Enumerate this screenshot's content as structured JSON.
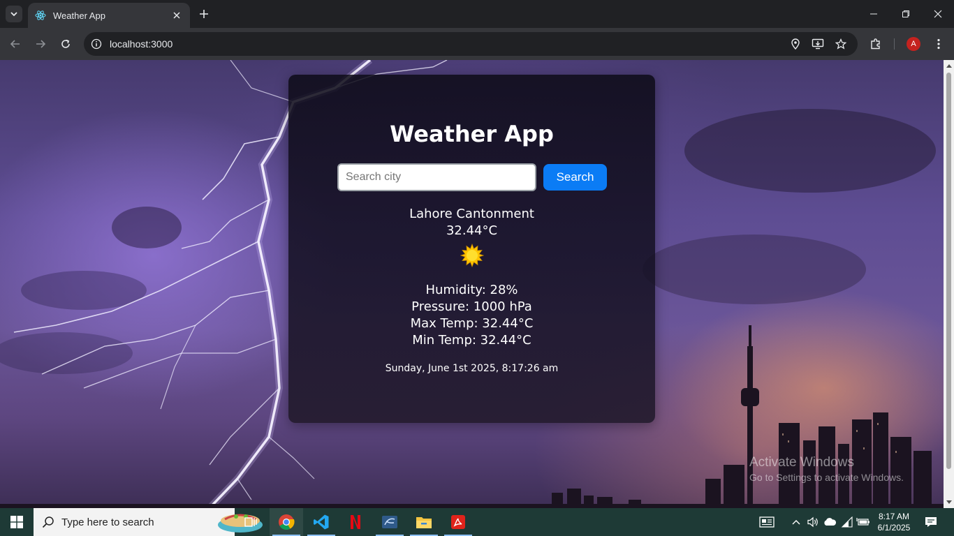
{
  "browser": {
    "tab_title": "Weather App",
    "url": "localhost:3000",
    "profile_initial": "A"
  },
  "app": {
    "title": "Weather App",
    "search_placeholder": "Search city",
    "search_value": "",
    "search_button": "Search",
    "city": "Lahore Cantonment",
    "temperature": "32.44°C",
    "weather_icon": "sun-icon",
    "humidity": "Humidity: 28%",
    "pressure": "Pressure: 1000 hPa",
    "max_temp": "Max Temp: 32.44°C",
    "min_temp": "Min Temp: 32.44°C",
    "datetime": "Sunday, June 1st 2025, 8:17:26 am"
  },
  "watermark": {
    "title": "Activate Windows",
    "subtitle": "Go to Settings to activate Windows."
  },
  "taskbar": {
    "search_placeholder": "Type here to search",
    "apps": [
      "task-view-icon",
      "chrome-icon",
      "vscode-icon",
      "netflix-icon",
      "ssms-icon",
      "file-explorer-icon",
      "acrobat-icon"
    ],
    "time": "8:17 AM",
    "date": "6/1/2025"
  },
  "colors": {
    "accent_button": "#0b7cf5",
    "taskbar": "#1e3a36",
    "chrome_dark": "#202124"
  }
}
